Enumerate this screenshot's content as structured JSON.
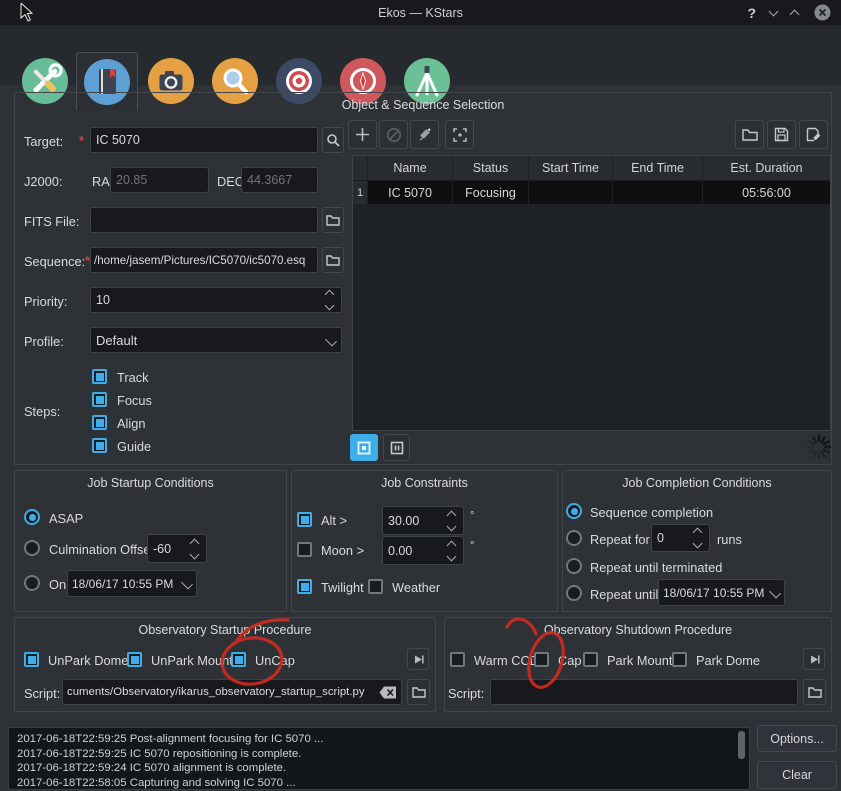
{
  "window": {
    "title": "Ekos — KStars",
    "controls": {
      "help": "?",
      "close": "×"
    }
  },
  "tabs": [
    {
      "name": "setup",
      "icon": "tools-icon",
      "color": "#66bd98",
      "selected": false
    },
    {
      "name": "scheduler",
      "icon": "scheduler-book-icon",
      "color": "#5e9fd4",
      "selected": true
    },
    {
      "name": "capture",
      "icon": "camera-icon",
      "color": "#e5a043",
      "selected": false
    },
    {
      "name": "align",
      "icon": "search-icon",
      "color": "#e5a043",
      "selected": false
    },
    {
      "name": "focus",
      "icon": "target-icon",
      "color": "#3c4b63",
      "selected": false
    },
    {
      "name": "guide",
      "icon": "compass-icon",
      "color": "#ce585c",
      "selected": false
    },
    {
      "name": "mount",
      "icon": "tripod-icon",
      "color": "#6cc095",
      "selected": false
    }
  ],
  "seq": {
    "title": "Object & Sequence Selection",
    "target_label": "Target:",
    "required_marker": "*",
    "target_value": "IC 5070",
    "j2000_label": "J2000:",
    "ra_label": "RA",
    "ra_value": "20.85",
    "dec_label": "DEC",
    "dec_value": "44.3667",
    "fits_label": "FITS File:",
    "fits_value": "",
    "sequence_label": "Sequence:",
    "sequence_value": "/home/jasem/Pictures/IC5070/ic5070.esq",
    "priority_label": "Priority:",
    "priority_value": "10",
    "profile_label": "Profile:",
    "profile_value": "Default",
    "steps_label": "Steps:",
    "steps": [
      {
        "label": "Track",
        "checked": true
      },
      {
        "label": "Focus",
        "checked": true
      },
      {
        "label": "Align",
        "checked": true
      },
      {
        "label": "Guide",
        "checked": true
      }
    ],
    "table": {
      "headers": [
        "Name",
        "Status",
        "Start Time",
        "End Time",
        "Est. Duration"
      ],
      "rows": [
        {
          "num": "1",
          "name": "IC 5070",
          "status": "Focusing",
          "start_time": "",
          "end_time": "",
          "est_duration": "05:56:00"
        }
      ]
    }
  },
  "job_startup": {
    "title": "Job Startup Conditions",
    "asap_label": "ASAP",
    "asap_selected": true,
    "culmination_label": "Culmination Offset",
    "culmination_value": "-60",
    "on_label": "On",
    "on_value": "18/06/17 10:55 PM"
  },
  "job_constraints": {
    "title": "Job Constraints",
    "alt_label": "Alt >",
    "alt_checked": true,
    "alt_value": "30.00",
    "moon_label": "Moon >",
    "moon_checked": false,
    "moon_value": "0.00",
    "twilight_label": "Twilight",
    "twilight_checked": true,
    "weather_label": "Weather",
    "weather_checked": false,
    "degree": "°"
  },
  "job_completion": {
    "title": "Job Completion Conditions",
    "sequence_label": "Sequence completion",
    "sequence_selected": true,
    "repeat_for_label": "Repeat for",
    "repeat_for_value": "0",
    "runs_label": "runs",
    "repeat_terminated_label": "Repeat until terminated",
    "repeat_until_label": "Repeat until",
    "repeat_until_value": "18/06/17 10:55 PM"
  },
  "startup_proc": {
    "title": "Observatory Startup Procedure",
    "unpark_dome_label": "UnPark Dome",
    "unpark_dome_checked": true,
    "unpark_mount_label": "UnPark Mount",
    "unpark_mount_checked": true,
    "uncap_label": "UnCap",
    "uncap_checked": true,
    "script_label": "Script:",
    "script_value": "cuments/Observatory/ikarus_observatory_startup_script.py"
  },
  "shutdown_proc": {
    "title": "Observatory Shutdown Procedure",
    "warm_ccd_label": "Warm CCD",
    "warm_ccd_checked": false,
    "cap_label": "Cap",
    "cap_checked": false,
    "park_mount_label": "Park Mount",
    "park_mount_checked": false,
    "park_dome_label": "Park Dome",
    "park_dome_checked": false,
    "script_label": "Script:",
    "script_value": ""
  },
  "log": {
    "lines": [
      "2017-06-18T22:59:25 Post-alignment focusing for IC 5070 ...",
      "2017-06-18T22:59:25 IC 5070 repositioning is complete.",
      "2017-06-18T22:59:24 IC 5070 alignment is complete.",
      "2017-06-18T22:58:05 Capturing and solving IC 5070 ..."
    ]
  },
  "actions": {
    "options": "Options...",
    "clear": "Clear"
  },
  "colors": {
    "accent": "#3daee9",
    "annotation": "#cf2b1f"
  }
}
